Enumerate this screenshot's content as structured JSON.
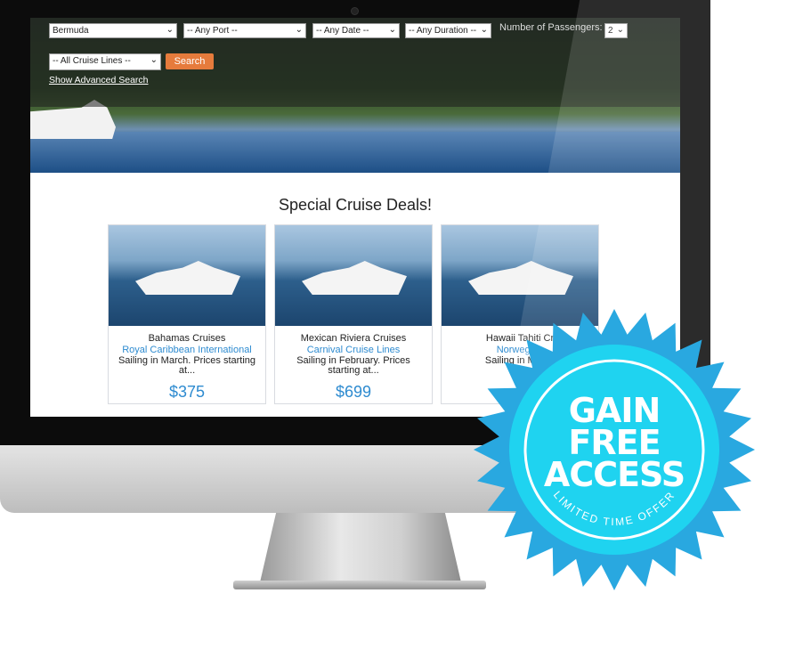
{
  "search": {
    "destination": "Bermuda",
    "port": "-- Any Port --",
    "date": "-- Any Date --",
    "duration": "-- Any Duration --",
    "passengers_label": "Number of Passengers:",
    "passengers": "2",
    "cruise_line": "-- All Cruise Lines --",
    "search_label": "Search",
    "advanced_link": "Show Advanced Search"
  },
  "section_title": "Special Cruise Deals!",
  "deals": [
    {
      "name": "Bahamas Cruises",
      "line": "Royal Caribbean International",
      "desc": "Sailing in March. Prices starting at...",
      "price": "$375"
    },
    {
      "name": "Mexican Riviera Cruises",
      "line": "Carnival Cruise Lines",
      "desc": "Sailing in February. Prices starting at...",
      "price": "$699"
    },
    {
      "name": "Hawaii Tahiti Cr",
      "line": "Norwegian",
      "desc": "Sailing in March"
    }
  ],
  "badge": {
    "line1": "GAIN",
    "line2": "FREE",
    "line3": "ACCESS",
    "sub": "LIMITED TIME OFFER",
    "color": "#29a8e0",
    "inner": "#1fd3f0"
  }
}
